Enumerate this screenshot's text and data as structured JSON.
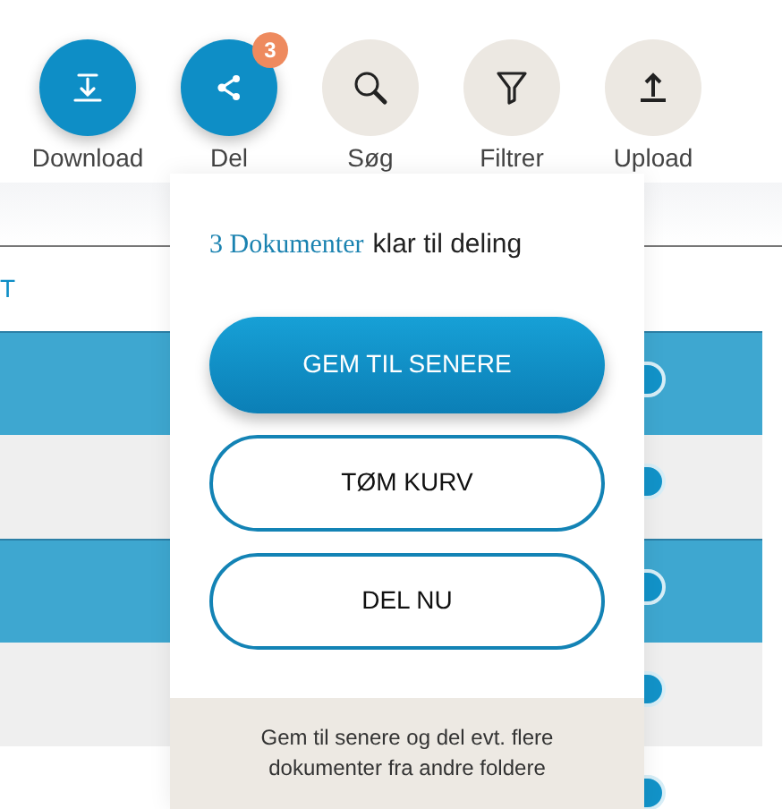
{
  "toolbar": [
    {
      "label": "Download",
      "kind": "download",
      "active": true
    },
    {
      "label": "Del",
      "kind": "share",
      "active": true,
      "badge": "3"
    },
    {
      "label": "Søg",
      "kind": "search",
      "active": false
    },
    {
      "label": "Filtrer",
      "kind": "filter",
      "active": false
    },
    {
      "label": "Upload",
      "kind": "upload",
      "active": false
    }
  ],
  "table": {
    "column_1": "T",
    "rows": [
      {
        "selected": true
      },
      {
        "selected": false
      },
      {
        "selected": true
      },
      {
        "selected": false
      },
      {
        "selected": false
      }
    ]
  },
  "popover": {
    "count_link": "3 Dokumenter",
    "message": "klar til deling",
    "buttons": [
      {
        "label": "GEM TIL SENERE",
        "kind": "primary"
      },
      {
        "label": "TØM KURV",
        "kind": "outline"
      },
      {
        "label": "DEL NU",
        "kind": "outline"
      }
    ],
    "footer": "Gem til senere og del evt. flere dokumenter fra andre foldere"
  }
}
